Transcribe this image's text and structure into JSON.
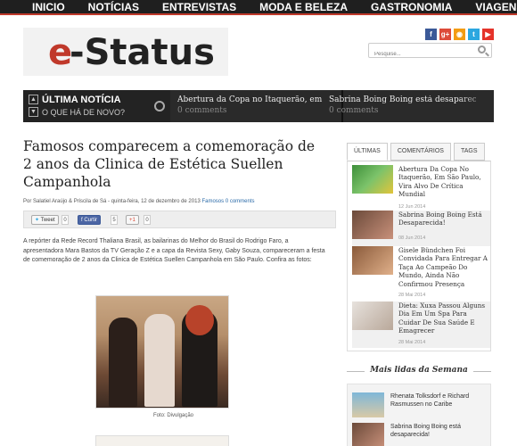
{
  "nav": {
    "items": [
      "INICIO",
      "NOTÍCIAS",
      "ENTREVISTAS",
      "MODA E BELEZA",
      "GASTRONOMIA",
      "VIAGENS"
    ]
  },
  "logo": {
    "e": "e",
    "rest": "-Status"
  },
  "social": {
    "icons": [
      {
        "name": "facebook-icon",
        "glyph": "f",
        "color": "#3b5998"
      },
      {
        "name": "googleplus-icon",
        "glyph": "g+",
        "color": "#dd4b39"
      },
      {
        "name": "rss-icon",
        "glyph": "◉",
        "color": "#f39c12"
      },
      {
        "name": "twitter-icon",
        "glyph": "t",
        "color": "#2ca7e0"
      },
      {
        "name": "youtube-icon",
        "glyph": "▶",
        "color": "#e5332a"
      }
    ]
  },
  "search": {
    "placeholder": "Pesquise..."
  },
  "ticker": {
    "title": "ÚLTIMA NOTÍCIA",
    "subtitle": "O QUE HÁ DE NOVO?",
    "items": [
      {
        "headline": "Abertura da Copa no Itaquerão, em",
        "comments": "0 comments"
      },
      {
        "headline": "Sabrina Boing Boing está desapareci",
        "comments": "0 comments"
      }
    ]
  },
  "article": {
    "title": "Famosos comparecem a comemoração de 2 anos da Clinica de Estética Suellen Campanhola",
    "meta_prefix": "Por Salatiel Araújo & Priscila de Sá - quinta-feira, 12 de dezembro de 2013",
    "meta_category": "Famosos",
    "meta_comments": "0 comments",
    "share": {
      "tweet": "Tweet",
      "tweet_count": "0",
      "like": "Curtir",
      "like_count": "5",
      "gplus": "+1",
      "gplus_count": "0"
    },
    "body": "A repórter da Rede Record Thaliana Brasil, as bailarinas do Melhor do Brasil do Rodrigo Faro, a apresentadora Mara Bastos da TV Geração Z e a capa da Revista Sexy, Gaby Souza, compareceram a festa de comemoração de 2 anos da Clinica de Estética Suellen Campanhola em São Paulo. Confira as fotos:",
    "caption": "Foto: Divulgação"
  },
  "sidebar": {
    "tabs": [
      "ÚLTIMAS",
      "COMENTÁRIOS",
      "TAGS"
    ],
    "posts": [
      {
        "title": "Abertura Da Copa No Itaquerão, Em São Paulo, Vira Alvo De Crítica Mundial",
        "date": "12 Jun 2014"
      },
      {
        "title": "Sabrina Boing Boing Está Desaparecida!",
        "date": "08 Jun 2014"
      },
      {
        "title": "Gisele Bündchen Foi Convidada Para Entregar A Taça Ao Campeão Do Mundo, Ainda Não Confirmou Presença",
        "date": "28 Mai 2014"
      },
      {
        "title": "Dieta: Xuxa Passou Alguns Dia Em Um Spa Para Cuidar De Sua Saúde E Emagrecer",
        "date": "28 Mai 2014"
      }
    ],
    "most_read_title": "Mais lidas da Semana",
    "most_read": [
      {
        "title": "Rhenata Tolksdorf e Richard Rasmussen no Caribe"
      },
      {
        "title": "Sabrina Boing Boing está desaparecida!"
      }
    ]
  }
}
